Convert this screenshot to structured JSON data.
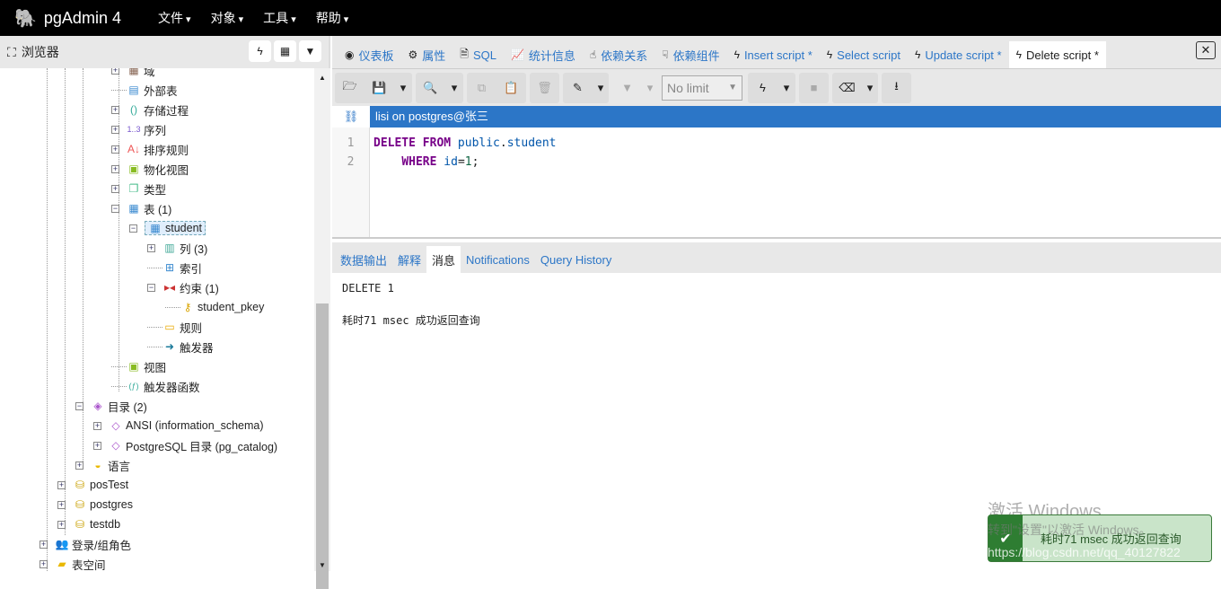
{
  "app": {
    "title": "pgAdmin 4",
    "menus": [
      "文件",
      "对象",
      "工具",
      "帮助"
    ]
  },
  "browser": {
    "title": "浏览器",
    "tree": [
      {
        "label": "域",
        "depth": 4,
        "exp": "+",
        "icon": "domain-icon",
        "glyph": "▦",
        "color": "#865"
      },
      {
        "label": "外部表",
        "depth": 4,
        "exp": "",
        "icon": "foreign-table-icon",
        "glyph": "▤",
        "color": "#3a8ad0"
      },
      {
        "label": "存储过程",
        "depth": 4,
        "exp": "+",
        "icon": "procedure-icon",
        "glyph": "()",
        "color": "#3a9"
      },
      {
        "label": "序列",
        "depth": 4,
        "exp": "+",
        "icon": "sequence-icon",
        "glyph": "1..3",
        "color": "#75c"
      },
      {
        "label": "排序规则",
        "depth": 4,
        "exp": "+",
        "icon": "collation-icon",
        "glyph": "A↓",
        "color": "#e55"
      },
      {
        "label": "物化视图",
        "depth": 4,
        "exp": "+",
        "icon": "materialized-view-icon",
        "glyph": "▣",
        "color": "#8b2"
      },
      {
        "label": "类型",
        "depth": 4,
        "exp": "+",
        "icon": "type-icon",
        "glyph": "❐",
        "color": "#4b8"
      },
      {
        "label": "表 (1)",
        "depth": 4,
        "exp": "-",
        "icon": "tables-icon",
        "glyph": "▦",
        "color": "#3a8ad0"
      },
      {
        "label": "student",
        "depth": 5,
        "exp": "-",
        "icon": "table-icon",
        "glyph": "▦",
        "color": "#3a8ad0",
        "selected": true
      },
      {
        "label": "列 (3)",
        "depth": 6,
        "exp": "+",
        "icon": "columns-icon",
        "glyph": "▥",
        "color": "#4a9"
      },
      {
        "label": "索引",
        "depth": 6,
        "exp": "",
        "icon": "index-icon",
        "glyph": "⊞",
        "color": "#3a8ad0"
      },
      {
        "label": "约束 (1)",
        "depth": 6,
        "exp": "-",
        "icon": "constraints-icon",
        "glyph": "▸◂",
        "color": "#c33"
      },
      {
        "label": "student_pkey",
        "depth": 7,
        "exp": "",
        "icon": "key-icon",
        "glyph": "⚷",
        "color": "#d9a400"
      },
      {
        "label": "规则",
        "depth": 6,
        "exp": "",
        "icon": "rules-icon",
        "glyph": "▭",
        "color": "#e9a800"
      },
      {
        "label": "触发器",
        "depth": 6,
        "exp": "",
        "icon": "trigger-icon",
        "glyph": "➜",
        "color": "#1a7a9a"
      },
      {
        "label": "视图",
        "depth": 4,
        "exp": "",
        "icon": "view-icon",
        "glyph": "▣",
        "color": "#8b2"
      },
      {
        "label": "触发器函数",
        "depth": 4,
        "exp": "",
        "icon": "trigger-function-icon",
        "glyph": "(ƒ)",
        "color": "#3a9"
      },
      {
        "label": "目录 (2)",
        "depth": 2,
        "exp": "-",
        "icon": "catalogs-icon",
        "glyph": "◈",
        "color": "#a5c"
      },
      {
        "label": "ANSI (information_schema)",
        "depth": 3,
        "exp": "+",
        "icon": "catalog-icon",
        "glyph": "◇",
        "color": "#a5c"
      },
      {
        "label": "PostgreSQL 目录 (pg_catalog)",
        "depth": 3,
        "exp": "+",
        "icon": "catalog-icon",
        "glyph": "◇",
        "color": "#a5c"
      },
      {
        "label": "语言",
        "depth": 2,
        "exp": "+",
        "icon": "language-icon",
        "glyph": "◒",
        "color": "#e9b800"
      },
      {
        "label": "posTest",
        "depth": 1,
        "exp": "+",
        "icon": "database-icon",
        "glyph": "⛁",
        "color": "#c9a000"
      },
      {
        "label": "postgres",
        "depth": 1,
        "exp": "+",
        "icon": "database-icon",
        "glyph": "⛁",
        "color": "#c9a000"
      },
      {
        "label": "testdb",
        "depth": 1,
        "exp": "+",
        "icon": "database-icon",
        "glyph": "⛁",
        "color": "#c9a000"
      },
      {
        "label": "登录/组角色",
        "depth": 0,
        "exp": "+",
        "icon": "roles-icon",
        "glyph": "👥",
        "color": "#c44"
      },
      {
        "label": "表空间",
        "depth": 0,
        "exp": "+",
        "icon": "tablespace-icon",
        "glyph": "▰",
        "color": "#e9b800"
      }
    ]
  },
  "tabs": [
    {
      "label": "仪表板",
      "icon": "dashboard-icon",
      "glyph": "◉"
    },
    {
      "label": "属性",
      "icon": "properties-icon",
      "glyph": "⚙"
    },
    {
      "label": "SQL",
      "icon": "sql-file-icon",
      "glyph": "🗎"
    },
    {
      "label": "统计信息",
      "icon": "statistics-icon",
      "glyph": "📈"
    },
    {
      "label": "依赖关系",
      "icon": "dependencies-icon",
      "glyph": "☝"
    },
    {
      "label": "依赖组件",
      "icon": "dependents-icon",
      "glyph": "☟"
    },
    {
      "label": "Insert script *",
      "icon": "bolt-icon",
      "glyph": "ϟ"
    },
    {
      "label": "Select script",
      "icon": "bolt-icon",
      "glyph": "ϟ"
    },
    {
      "label": "Update script *",
      "icon": "bolt-icon",
      "glyph": "ϟ"
    },
    {
      "label": "Delete script *",
      "icon": "bolt-icon",
      "glyph": "ϟ",
      "active": true
    }
  ],
  "toolbar": {
    "limit": "No limit"
  },
  "connection": "lisi on postgres@张三",
  "editor": {
    "line_numbers": [
      "1",
      "2"
    ]
  },
  "result_tabs": [
    {
      "label": "数据输出"
    },
    {
      "label": "解释"
    },
    {
      "label": "消息",
      "active": true
    },
    {
      "label": "Notifications"
    },
    {
      "label": "Query History"
    }
  ],
  "messages": [
    "DELETE 1",
    "",
    "耗时71 msec 成功返回查询"
  ],
  "toast": "耗时71 msec 成功返回查询",
  "watermark": {
    "line1": "激活 Windows",
    "line2": "转到\"设置\"以激活 Windows。",
    "url": "https://blog.csdn.net/qq_40127822"
  }
}
